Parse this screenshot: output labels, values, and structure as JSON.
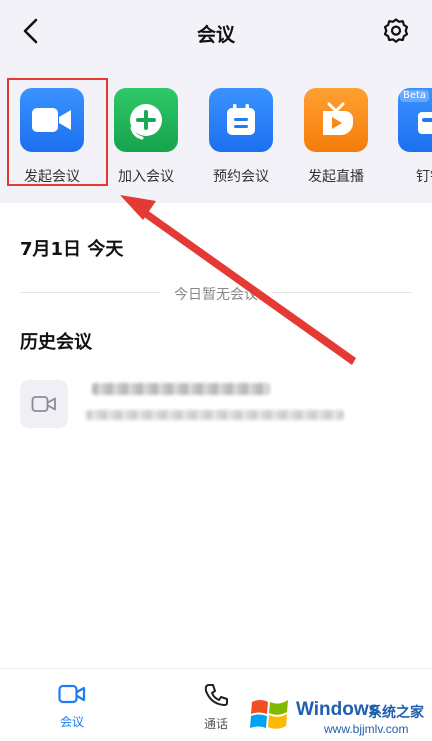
{
  "header": {
    "title": "会议",
    "back_icon": "chevron-left-icon",
    "settings_icon": "gear-icon"
  },
  "quick_actions": [
    {
      "label": "发起会议",
      "icon": "video-camera-icon",
      "color": "#1f7cf5"
    },
    {
      "label": "加入会议",
      "icon": "plus-circle-icon",
      "color": "#20b35a"
    },
    {
      "label": "预约会议",
      "icon": "calendar-icon",
      "color": "#1f7cf5"
    },
    {
      "label": "发起直播",
      "icon": "tv-play-icon",
      "color": "#f98a12"
    },
    {
      "label": "钉钉",
      "icon": "app-window-icon",
      "color": "#1f7cf5",
      "badge": "Beta"
    }
  ],
  "today": {
    "date_label": "7月1日 今天",
    "empty_text": "今日暂无会议"
  },
  "history": {
    "heading": "历史会议",
    "items": [
      {
        "icon": "video-camera-outline-icon"
      }
    ]
  },
  "tabbar": {
    "tabs": [
      {
        "label": "会议",
        "icon": "video-camera-icon",
        "active": true
      },
      {
        "label": "通话",
        "icon": "phone-icon",
        "active": false
      }
    ],
    "active_color": "#1f7cf5"
  },
  "watermark": {
    "title": "Windows",
    "subtitle": "系统之家",
    "url": "www.bjjmlv.com"
  }
}
